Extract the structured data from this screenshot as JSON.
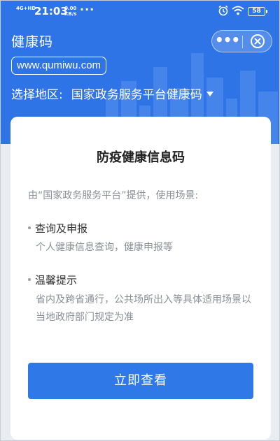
{
  "status_bar": {
    "network": "4G+HD",
    "time": "21:03",
    "speed_value": "0.00",
    "speed_unit": "KB/s",
    "more": "···",
    "battery": "58",
    "icons": [
      "signal-icon",
      "alarm-icon",
      "wifi-icon",
      "battery-icon"
    ]
  },
  "header": {
    "title": "健康码",
    "more_label": "•••",
    "url": "www.qumiwu.com",
    "region_label": "选择地区:",
    "region_value": "国家政务服务平台健康码"
  },
  "card": {
    "title": "防疫健康信息码",
    "intro": "由“国家政务服务平台”提供，使用场景:",
    "sections": [
      {
        "heading": "查询及申报",
        "body": "个人健康信息查询，健康申报等"
      },
      {
        "heading": "温馨提示",
        "body": "省内及跨省通行，公共场所出入等具体适用场景以当地政府部门规定为准"
      }
    ],
    "button_label": "立即查看"
  },
  "colors": {
    "header_blue": "#2f74e6",
    "button_blue": "#2f78e8",
    "page_bg": "#e9edf2"
  }
}
